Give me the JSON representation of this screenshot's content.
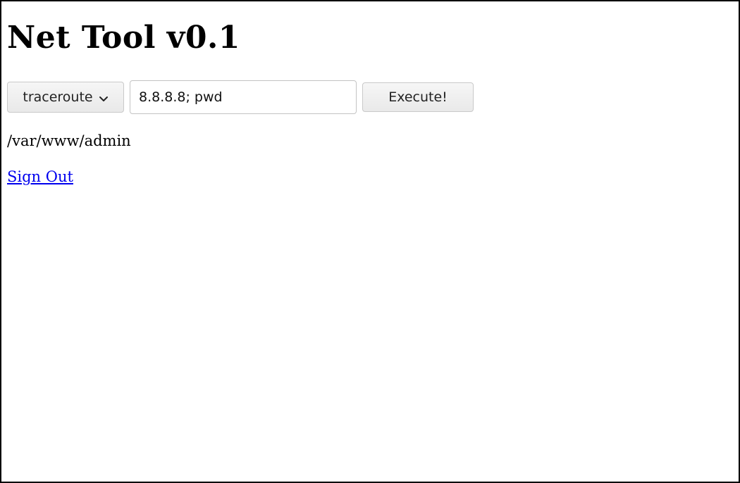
{
  "header": {
    "title": "Net Tool v0.1"
  },
  "form": {
    "tool_select": {
      "selected": "traceroute",
      "icon": "chevron-down-icon"
    },
    "command_input": {
      "value": "8.8.8.8; pwd"
    },
    "execute_label": "Execute!"
  },
  "output": {
    "text": "/var/www/admin"
  },
  "links": {
    "sign_out": "Sign Out"
  },
  "colors": {
    "link": "#0000ee",
    "border": "#000000"
  }
}
